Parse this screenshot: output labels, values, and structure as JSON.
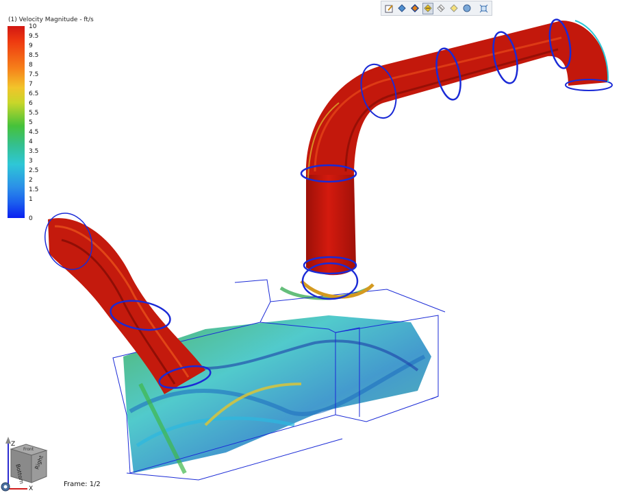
{
  "legend": {
    "title": "(1) Velocity Magnitude - ft/s",
    "ticks": [
      "10",
      "9.5",
      "9",
      "8.5",
      "8",
      "7.5",
      "7",
      "6.5",
      "6",
      "5.5",
      "5",
      "4.5",
      "4",
      "3.5",
      "3",
      "2.5",
      "2",
      "1.5",
      "1",
      "0"
    ]
  },
  "toolbar": {
    "buttons": [
      {
        "name": "edit-icon"
      },
      {
        "name": "shaded-icon"
      },
      {
        "name": "shaded-edges-icon"
      },
      {
        "name": "feature-lines-icon",
        "active": true
      },
      {
        "name": "wireframe-icon"
      },
      {
        "name": "transparent-icon"
      },
      {
        "name": "smooth-shaded-icon"
      },
      {
        "name": "fit-view-icon"
      }
    ]
  },
  "frame": {
    "text": "Frame: 1/2"
  },
  "viewcube": {
    "front": "Bottom",
    "right": "Right",
    "top": "Front",
    "axis_z": "Z",
    "axis_x": "X"
  },
  "colors": {
    "pipe_red": "#c8170d",
    "outline_blue": "#1a2ad6",
    "low_blue": "#0a1ff0",
    "cyan": "#2ec7d6",
    "green": "#46c23a"
  }
}
